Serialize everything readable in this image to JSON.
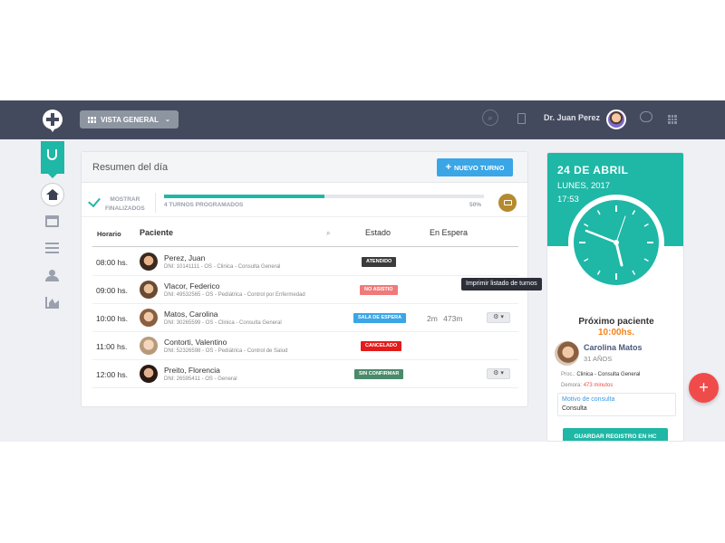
{
  "header": {
    "view_button_label": "VISTA GENERAL",
    "user_name": "Dr. Juan Perez"
  },
  "sidebar": {
    "items": [
      "stethoscope-icon",
      "home-icon",
      "calendar-icon",
      "list-icon",
      "users-icon",
      "chart-icon"
    ]
  },
  "summary": {
    "title": "Resumen del día",
    "new_turn_label": "NUEVO TURNO",
    "show_finished_label": "MOSTRAR FINALIZADOS",
    "progress_fraction": 0.5,
    "turns_label": "4 TURNOS PROGRAMADOS",
    "percent_label": "50%",
    "print_tooltip": "Imprimir listado de turnos"
  },
  "table": {
    "columns": {
      "horario": "Horario",
      "paciente": "Paciente",
      "estado": "Estado",
      "espera": "En Espera"
    },
    "rows": [
      {
        "time": "08:00 hs.",
        "name": "Perez, Juan",
        "info": "DNI: 10141111 - OS - Clinica - Consulta General",
        "status": "ATENDIDO",
        "status_color": "#3b3b3b"
      },
      {
        "time": "09:00 hs.",
        "name": "Vlacor, Federico",
        "info": "DNI: 49532565 - OS - Pediátrica - Control por Enfermedad",
        "status": "NO ASISTIO",
        "status_color": "#f07a7a"
      },
      {
        "time": "10:00 hs.",
        "name": "Matos, Carolina",
        "info": "DNI: 30265599 - OS - Clinica - Consulta General",
        "status": "SALA DE ESPERA",
        "status_color": "#3aa6e6",
        "wait": "2m 473m"
      },
      {
        "time": "11:00 hs.",
        "name": "Contorti, Valentino",
        "info": "DNI: 52326598 - OS - Pediátrica - Control de Salud",
        "status": "CANCELADO",
        "status_color": "#e31b1b"
      },
      {
        "time": "12:00 hs.",
        "name": "Preito, Florencia",
        "info": "DNI: 26595411 - OS - General",
        "status": "SIN CONFIRMAR",
        "status_color": "#4a8a6a"
      }
    ]
  },
  "right_panel": {
    "date": "24 DE ABRIL",
    "day": "LUNES, 2017",
    "time": "17:53",
    "next_title": "Próximo paciente",
    "next_hour": "10:00hs.",
    "patient_name": "Carolina Matos",
    "patient_age": "31 AÑOS",
    "proc_label": "Proc.:",
    "proc_value": "Clinica - Consulta General",
    "delay_label": "Demora:",
    "delay_value": "473 minutos",
    "motivo_label": "Motivo de consulta",
    "motivo_value": "Consulta",
    "save_label": "GUARDAR REGISTRO EN HC"
  },
  "colors": {
    "accent": "#1fb7a6",
    "topbar": "#444a5e",
    "primary_button": "#3aa6e6",
    "fab": "#f04b4b",
    "delay": "#e8504a",
    "next_hour": "#f5831f"
  }
}
